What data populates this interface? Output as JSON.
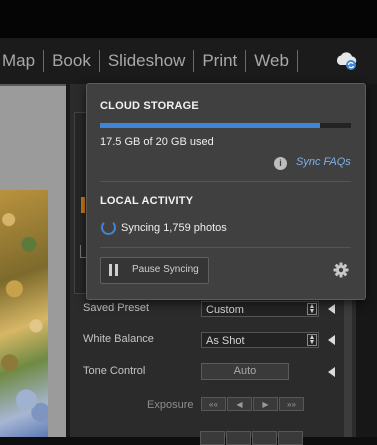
{
  "modules": [
    "Map",
    "Book",
    "Slideshow",
    "Print",
    "Web"
  ],
  "cloud_storage": {
    "title": "CLOUD STORAGE",
    "used_fraction": 0.875,
    "usage_text": "17.5 GB of 20 GB used",
    "faq_link": "Sync FAQs"
  },
  "local_activity": {
    "title": "LOCAL ACTIVITY",
    "status_text": "Syncing 1,759 photos",
    "pause_button": "Pause Syncing"
  },
  "develop_panel": {
    "saved_preset_label": "Saved Preset",
    "saved_preset_value": "Custom",
    "white_balance_label": "White Balance",
    "white_balance_value": "As Shot",
    "tone_control_label": "Tone Control",
    "auto_button": "Auto",
    "exposure_label": "Exposure",
    "exposure_buttons": [
      "««",
      "◀",
      "▶",
      "»»"
    ]
  },
  "colors": {
    "accent": "#3f86d6",
    "link": "#7fb1ea",
    "popover_bg": "#404040"
  },
  "icons": [
    "cloud-sync-icon",
    "info-icon",
    "sync-spinner-icon",
    "pause-icon",
    "gear-icon",
    "collapse-triangle-icon"
  ]
}
